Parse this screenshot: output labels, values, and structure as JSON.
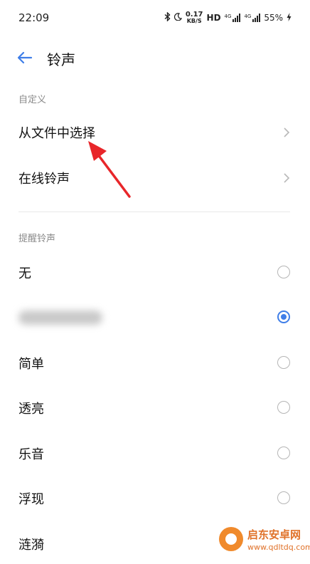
{
  "status_bar": {
    "time": "22:09",
    "net_speed_value": "0.17",
    "net_speed_unit": "KB/S",
    "hd": "HD",
    "signal1_label": "4G",
    "signal2_label": "4G",
    "battery": "55%"
  },
  "header": {
    "title": "铃声"
  },
  "custom_section": {
    "label": "自定义",
    "items": [
      {
        "label": "从文件中选择"
      },
      {
        "label": "在线铃声"
      }
    ]
  },
  "alert_section": {
    "label": "提醒铃声",
    "items": [
      {
        "label": "无",
        "selected": false
      },
      {
        "label": "",
        "selected": true
      },
      {
        "label": "简单",
        "selected": false
      },
      {
        "label": "透亮",
        "selected": false
      },
      {
        "label": "乐音",
        "selected": false
      },
      {
        "label": "浮现",
        "selected": false
      },
      {
        "label": "涟漪",
        "selected": false
      }
    ]
  },
  "watermark": {
    "name": "启东安卓网",
    "url": "www.qdltdq.com"
  },
  "colors": {
    "accent": "#3f7ee8",
    "arrow": "#e8262a"
  }
}
